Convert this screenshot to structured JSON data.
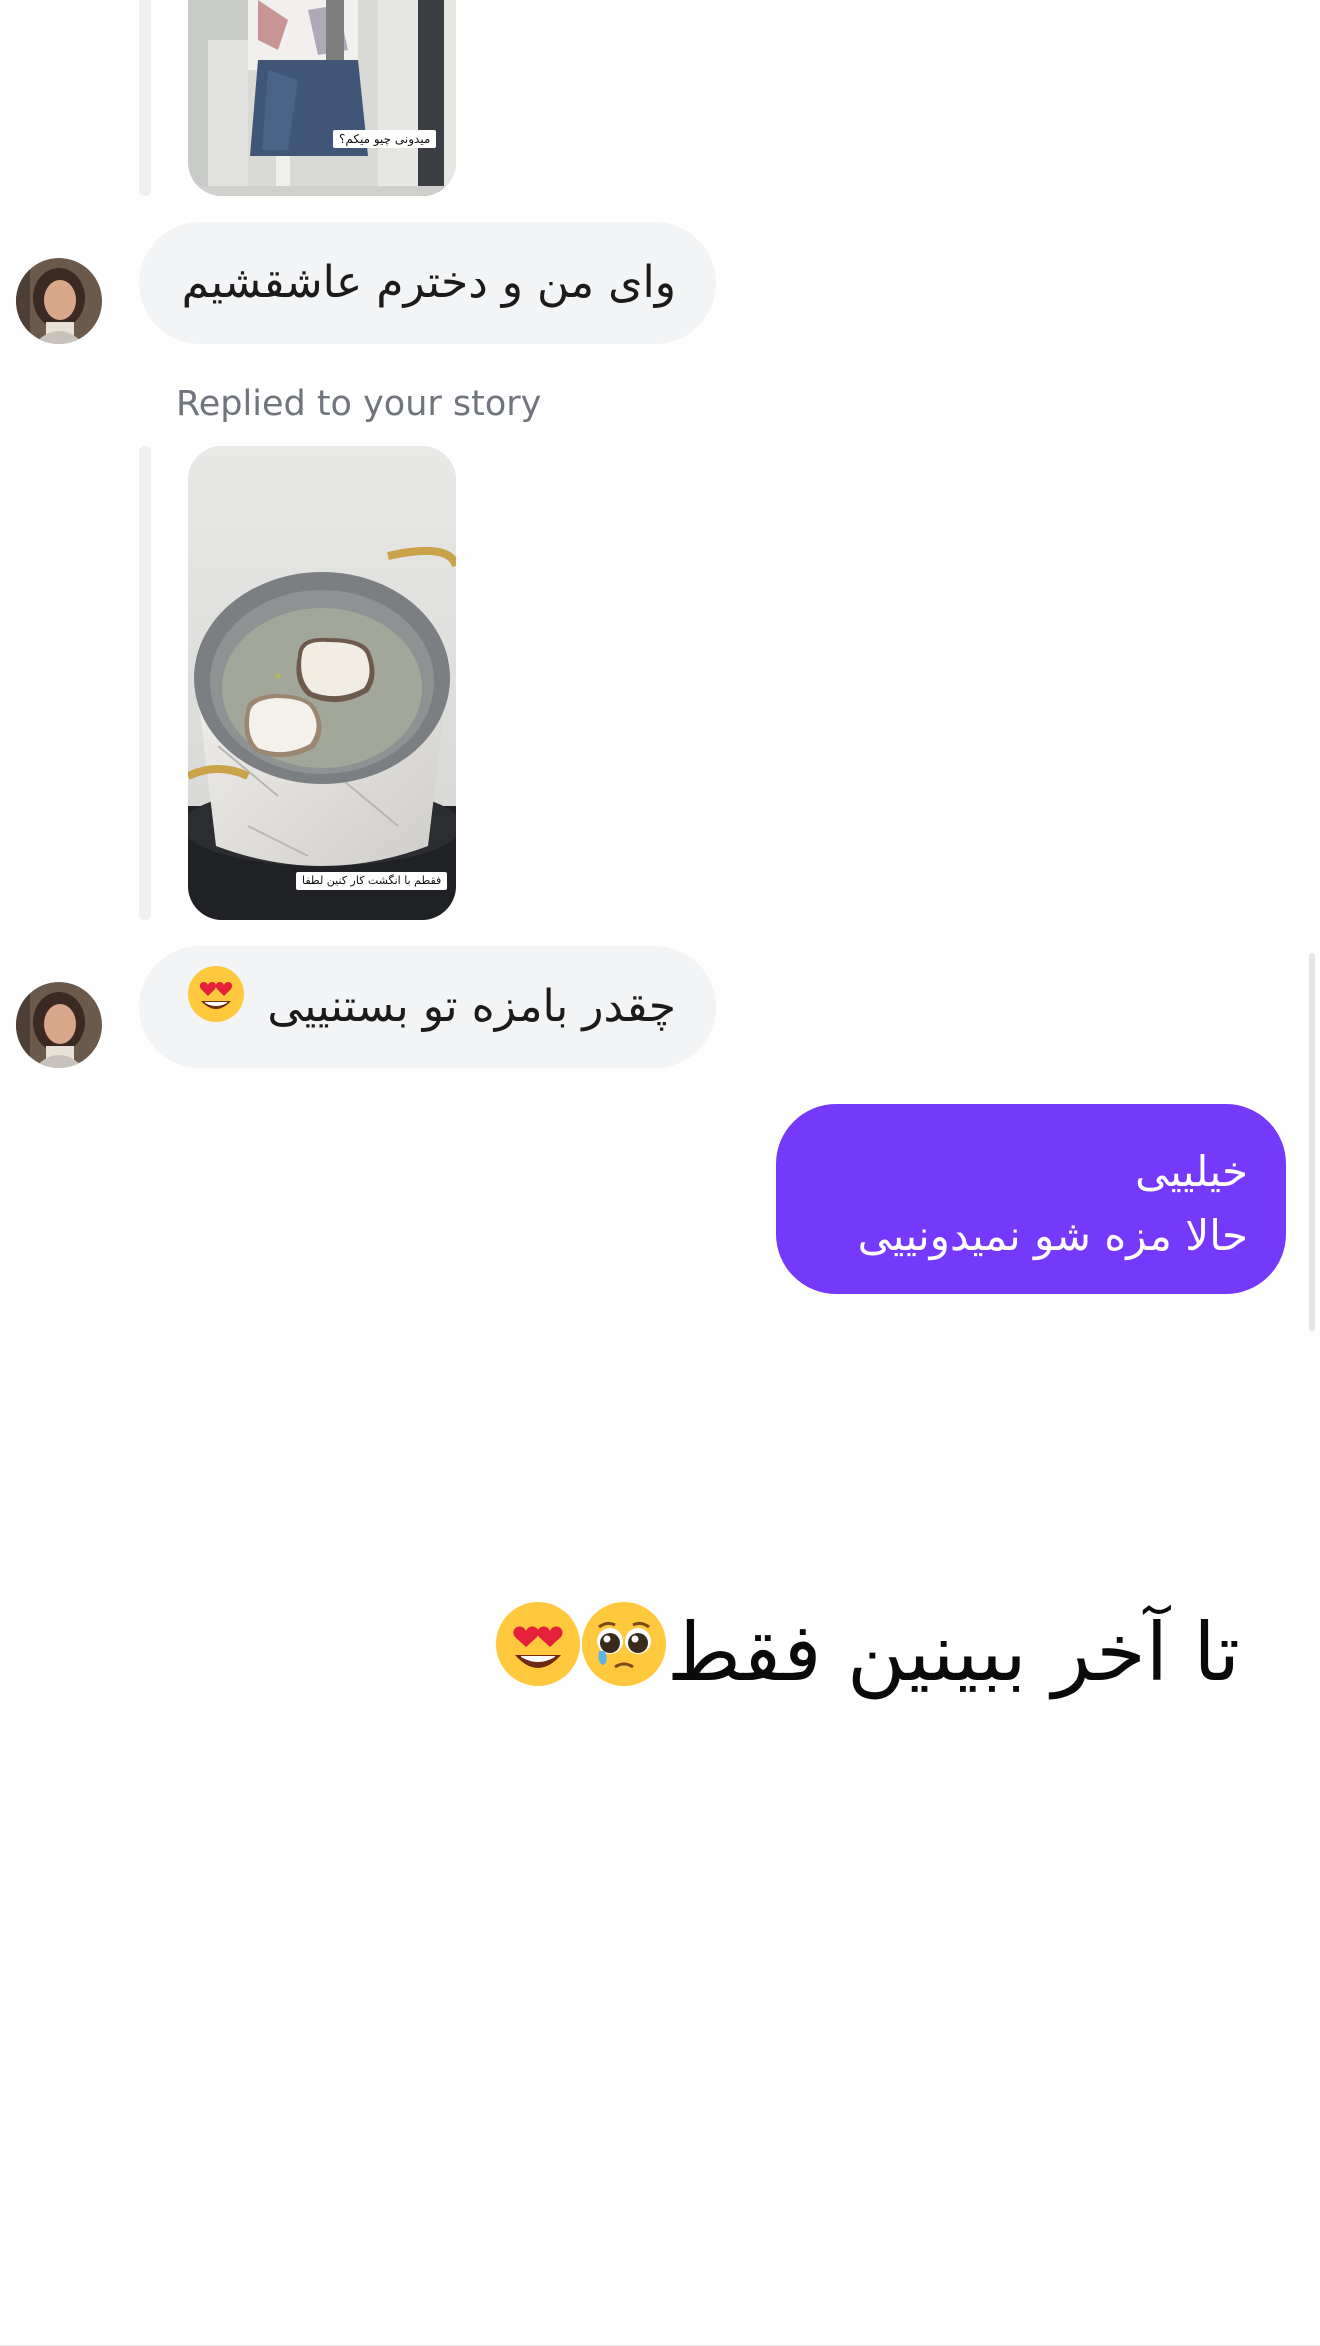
{
  "thread": {
    "replied_label": "Replied to your story",
    "story_1": {
      "caption": "میدونی چیو میکم؟"
    },
    "message_1": {
      "text": "وای من و دخترم عاشقشیم"
    },
    "story_2": {
      "caption": "فقطم با انگشت کار کنین لطفا"
    },
    "message_2": {
      "text": "چقدر بامزه تو بستنییی",
      "emoji": "smiling-face-with-heart-eyes"
    },
    "reply_out": {
      "line1": "خیلییی",
      "line2": "حالا مزه شو نمیدونییی"
    }
  },
  "overlay": {
    "caption": "تا آخر ببینین فقط",
    "emojis": [
      "pleading-face",
      "smiling-face-with-heart-eyes"
    ]
  },
  "colors": {
    "outgoing_bubble": "#7439fb",
    "incoming_bubble": "#f3f4f6",
    "meta_text": "#70747c"
  }
}
